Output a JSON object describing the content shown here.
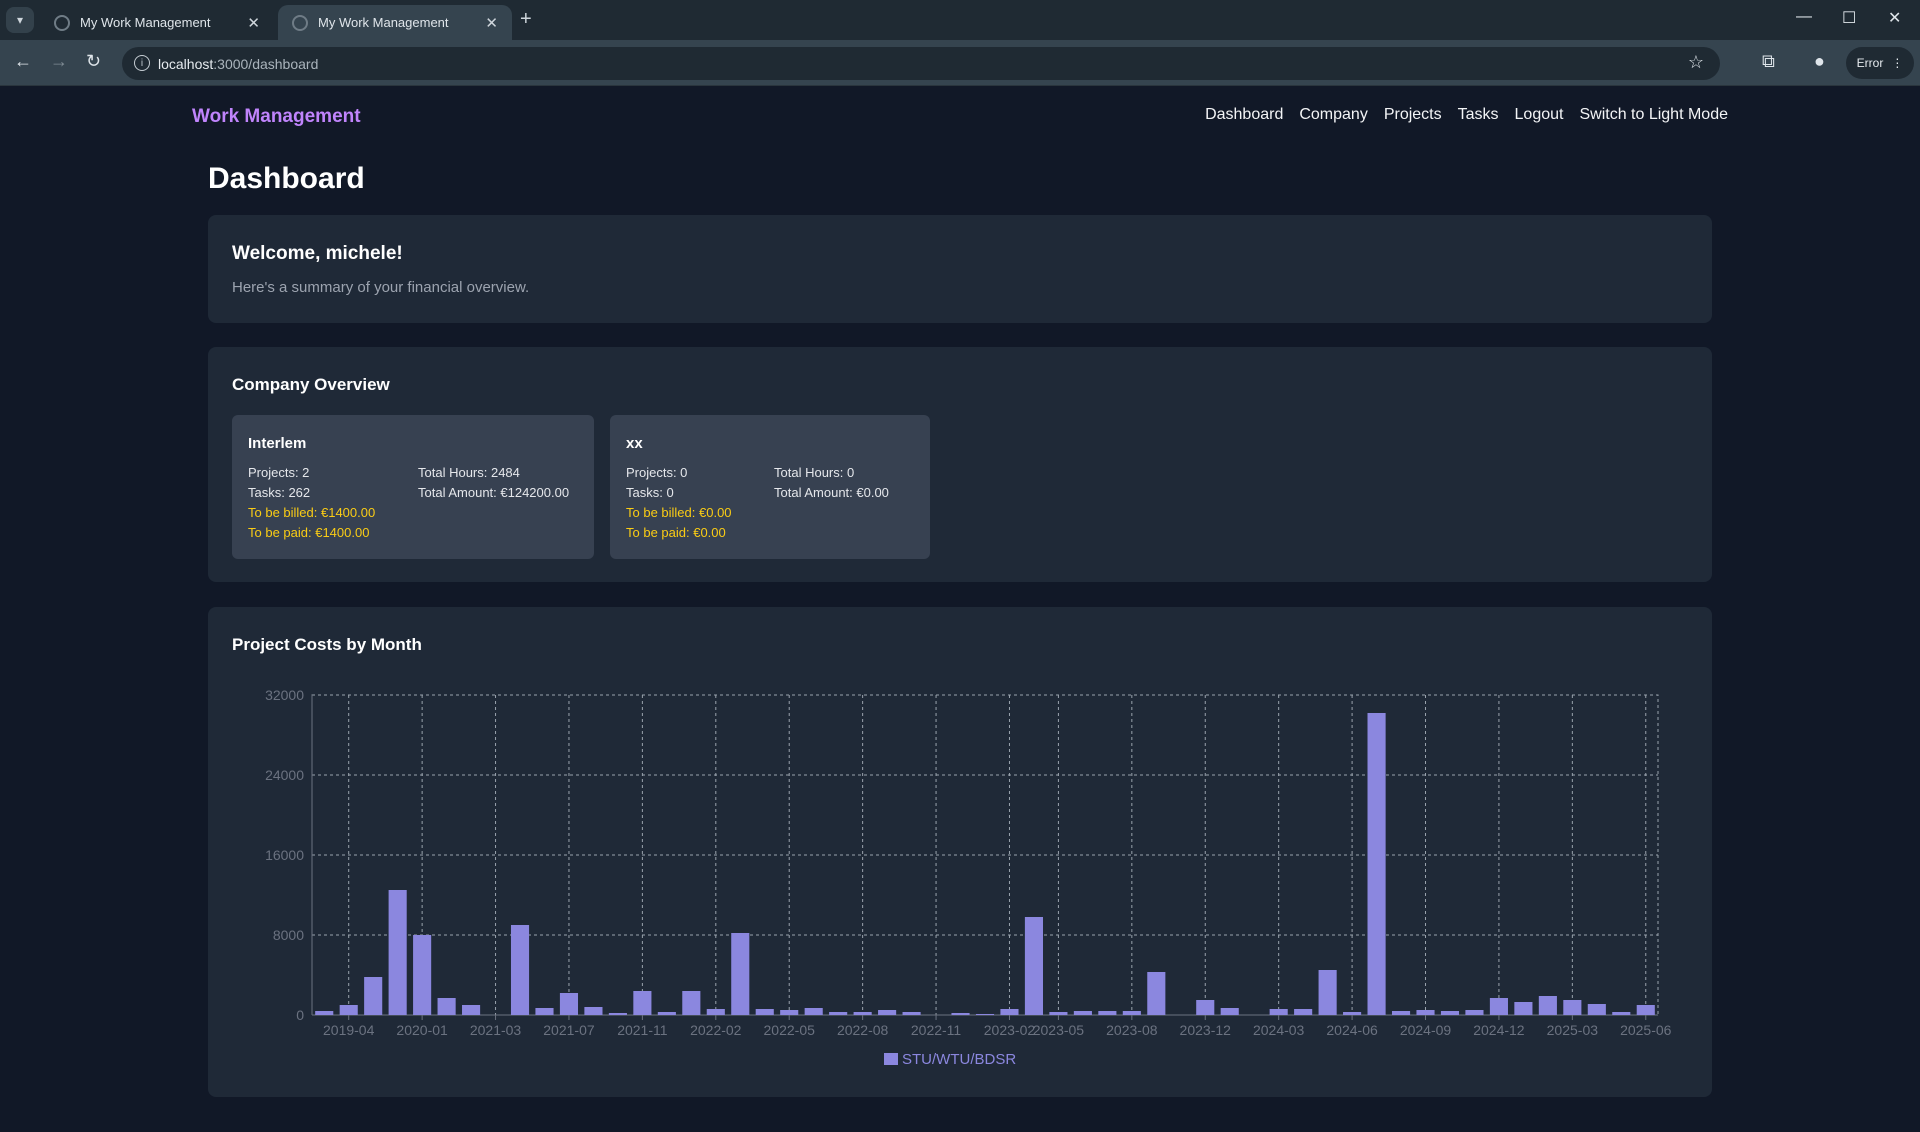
{
  "browser": {
    "tabs": [
      {
        "title": "My Work Management",
        "active": false
      },
      {
        "title": "My Work Management",
        "active": true
      }
    ],
    "url_host": "localhost",
    "url_path": ":3000/dashboard",
    "error_label": "Error"
  },
  "nav": {
    "brand": "Work Management",
    "links": [
      "Dashboard",
      "Company",
      "Projects",
      "Tasks",
      "Logout",
      "Switch to Light Mode"
    ]
  },
  "page": {
    "title": "Dashboard"
  },
  "welcome": {
    "heading": "Welcome, michele!",
    "subtitle": "Here's a summary of your financial overview."
  },
  "company_overview": {
    "title": "Company Overview",
    "companies": [
      {
        "name": "Interlem",
        "projects": "Projects: 2",
        "tasks": "Tasks: 262",
        "to_be_billed": "To be billed: €1400.00",
        "to_be_paid": "To be paid: €1400.00",
        "total_hours": "Total Hours: 2484",
        "total_amount": "Total Amount: €124200.00"
      },
      {
        "name": "xx",
        "projects": "Projects: 0",
        "tasks": "Tasks: 0",
        "to_be_billed": "To be billed: €0.00",
        "to_be_paid": "To be paid: €0.00",
        "total_hours": "Total Hours: 0",
        "total_amount": "Total Amount: €0.00"
      }
    ]
  },
  "chart_section": {
    "title": "Project Costs by Month"
  },
  "colors": {
    "bar": "#8b87df",
    "warn": "#facc15",
    "brand": "#c084fc"
  },
  "chart_data": {
    "type": "bar",
    "x_tick_labels": [
      "2019-04",
      "2020-01",
      "2021-03",
      "2021-07",
      "2021-11",
      "2022-02",
      "2022-05",
      "2022-08",
      "2022-11",
      "2023-02",
      "2023-05",
      "2023-08",
      "2023-12",
      "2024-03",
      "2024-06",
      "2024-09",
      "2024-12",
      "2025-03",
      "2025-06"
    ],
    "y_ticks": [
      0,
      8000,
      16000,
      24000,
      32000
    ],
    "ylim": [
      0,
      32000
    ],
    "grid": true,
    "legend": "bottom-center",
    "series": [
      {
        "name": "STU/WTU/BDSR",
        "values": [
          400,
          1000,
          3800,
          12500,
          8000,
          1700,
          1000,
          0,
          9000,
          700,
          2200,
          800,
          200,
          2400,
          300,
          2400,
          600,
          8200,
          600,
          500,
          700,
          300,
          300,
          500,
          300,
          0,
          200,
          100,
          600,
          9800,
          300,
          400,
          400,
          400,
          4300,
          0,
          1500,
          700,
          0,
          600,
          600,
          4500,
          300,
          30200,
          400,
          500,
          400,
          500,
          1700,
          1300,
          1900,
          1500,
          1100,
          300,
          1000
        ]
      }
    ]
  }
}
